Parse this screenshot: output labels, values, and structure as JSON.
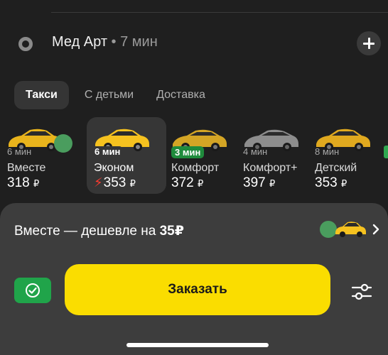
{
  "route": {
    "destination_name": "Мед Арт",
    "destination_eta": " • 7 мин"
  },
  "tabs": [
    {
      "label": "Такси",
      "active": true
    },
    {
      "label": "С детьми",
      "active": false
    },
    {
      "label": "Доставка",
      "active": false
    }
  ],
  "tariffs": [
    {
      "eta": "6 мин",
      "name": "Вместе",
      "price": "318",
      "currency": "₽"
    },
    {
      "eta": "6 мин",
      "name": "Эконом",
      "price": "353",
      "currency": "₽",
      "surge": "⚡"
    },
    {
      "eta": "3 мин",
      "name": "Комфорт",
      "price": "372",
      "currency": "₽"
    },
    {
      "eta": "4 мин",
      "name": "Комфорт+",
      "price": "397",
      "currency": "₽"
    },
    {
      "eta": "8 мин",
      "name": "Детский",
      "price": "353",
      "currency": "₽"
    }
  ],
  "promo": {
    "text": "Вместе — дешевле на ",
    "amount": "35₽"
  },
  "actions": {
    "order_label": "Заказать"
  },
  "colors": {
    "accent_yellow": "#fadd00",
    "pay_green": "#20a44a",
    "surge_red": "#ff3b30",
    "sheet_bg": "#3d3d3d"
  },
  "icons": {
    "destination": "destination-ring-icon",
    "add": "plus-icon",
    "payment": "check-circle-icon",
    "settings": "sliders-icon",
    "promo": "chevron-right-icon"
  }
}
